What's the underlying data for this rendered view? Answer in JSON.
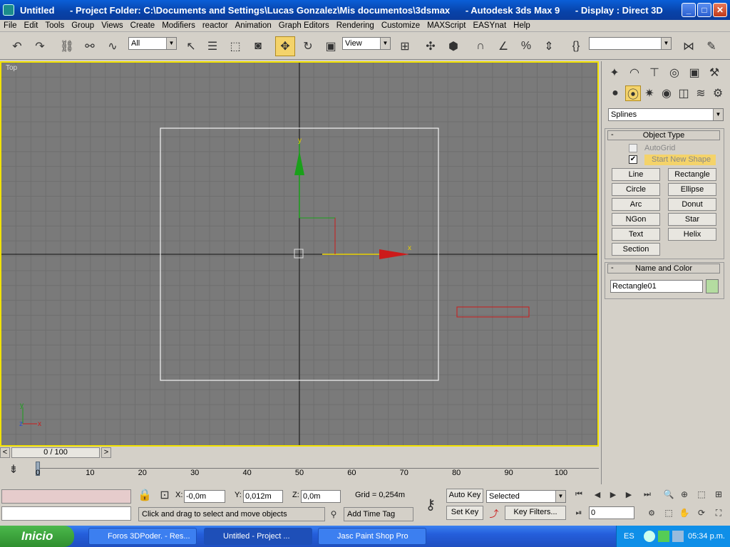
{
  "window": {
    "title": "Untitled      - Project Folder: C:\\Documents and Settings\\Lucas Gonzalez\\Mis documentos\\3dsmax      - Autodesk 3ds Max 9      - Display : Direct 3D",
    "minimize": "_",
    "maximize": "□",
    "close": "✕"
  },
  "menu": [
    "File",
    "Edit",
    "Tools",
    "Group",
    "Views",
    "Create",
    "Modifiers",
    "reactor",
    "Animation",
    "Graph Editors",
    "Rendering",
    "Customize",
    "MAXScript",
    "EASYnat",
    "Help"
  ],
  "toolbar": {
    "filter_value": "All",
    "refcoord_value": "View",
    "selection_set_value": ""
  },
  "viewport": {
    "label": "Top",
    "axis_y": "y",
    "axis_x": "x",
    "corner_y": "y",
    "corner_x": "x",
    "corner_z": "z"
  },
  "command_panel": {
    "category_value": "Splines",
    "object_type_header": "Object Type",
    "autogrid_label": "AutoGrid",
    "start_new_shape_label": "Start New Shape",
    "start_new_shape_checked": true,
    "buttons": [
      "Line",
      "Rectangle",
      "Circle",
      "Ellipse",
      "Arc",
      "Donut",
      "NGon",
      "Star",
      "Text",
      "Helix",
      "Section"
    ],
    "name_color_header": "Name and Color",
    "name_value": "Rectangle01",
    "object_color": "#b4dca0",
    "rollout_toggle": "-"
  },
  "time_slider": {
    "label": "0 / 100",
    "prev": "<",
    "next": ">"
  },
  "trackbar": {
    "ticks": [
      "0",
      "10",
      "20",
      "30",
      "40",
      "50",
      "60",
      "70",
      "80",
      "90",
      "100"
    ]
  },
  "status": {
    "x_label": "X:",
    "x_value": "-0,0m",
    "y_label": "Y:",
    "y_value": "0,012m",
    "z_label": "Z:",
    "z_value": "0,0m",
    "grid": "Grid = 0,254m",
    "prompt": "Click and drag to select and move objects",
    "add_time_tag": "Add Time Tag",
    "auto_key": "Auto Key",
    "set_key": "Set Key",
    "selected_value": "Selected",
    "key_filters": "Key Filters...",
    "frame_value": "0"
  },
  "taskbar": {
    "start_label": "Inicio",
    "tasks": [
      "Foros 3DPoder. - Res...",
      "Untitled     - Project ...",
      "Jasc Paint Shop Pro"
    ],
    "lang": "ES",
    "clock": "05:34 p.m."
  },
  "colors": {
    "viewport_bg": "#7a7a7a",
    "active_border": "#f2e200",
    "selection_red": "#cc1a1a",
    "gizmo_green": "#1aa01a"
  }
}
